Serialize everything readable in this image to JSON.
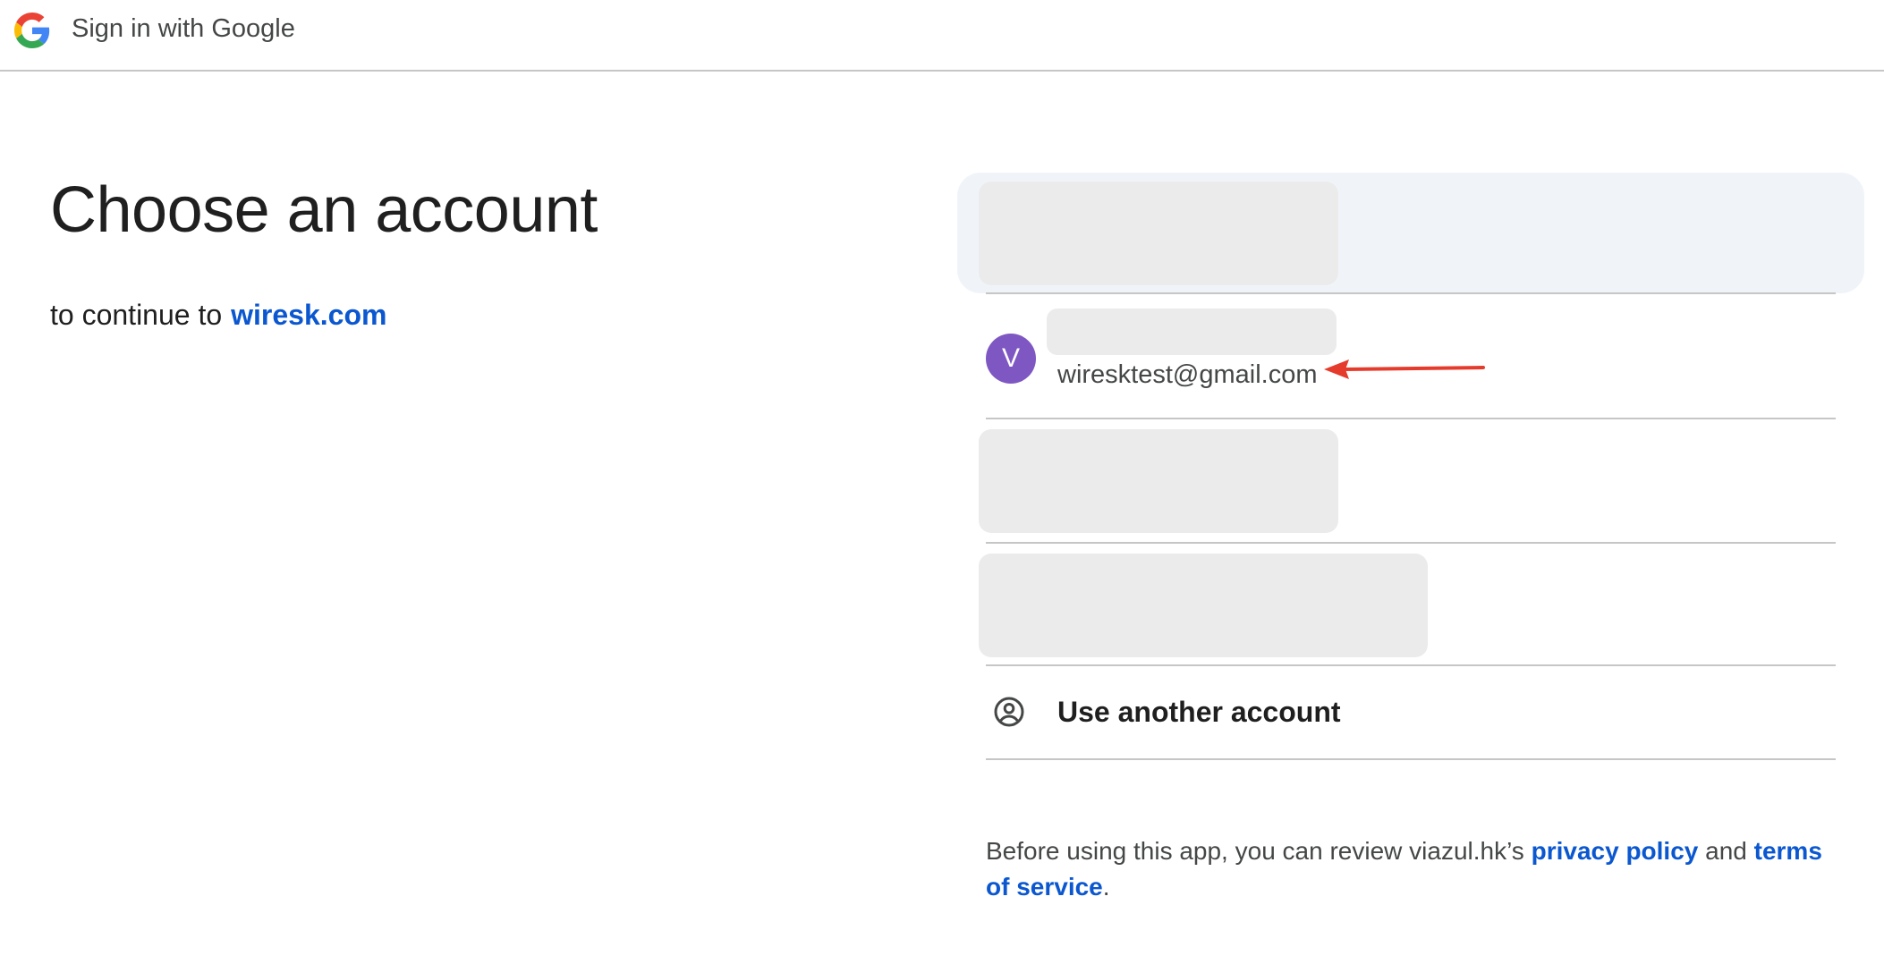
{
  "header": {
    "title": "Sign in with Google",
    "logo_icon": "google-g-icon"
  },
  "main": {
    "heading": "Choose an account",
    "subtitle_prefix": "to continue to",
    "subtitle_link": "wiresk.com"
  },
  "accounts": {
    "visible_account": {
      "avatar_letter": "V",
      "avatar_color": "#7e57c2",
      "email": "wiresktest@gmail.com"
    },
    "use_another_label": "Use another account",
    "use_another_icon": "account-circle-icon"
  },
  "footer": {
    "text_before": "Before using this app, you can review viazul.hk’s",
    "privacy_link": "privacy policy",
    "text_and": "and",
    "terms_link": "terms of service",
    "text_end": "."
  },
  "colors": {
    "link": "#0b57d0",
    "annotation_arrow": "#e53b2c",
    "highlight_bg": "#f0f4f9",
    "skeleton": "#ebebeb"
  }
}
